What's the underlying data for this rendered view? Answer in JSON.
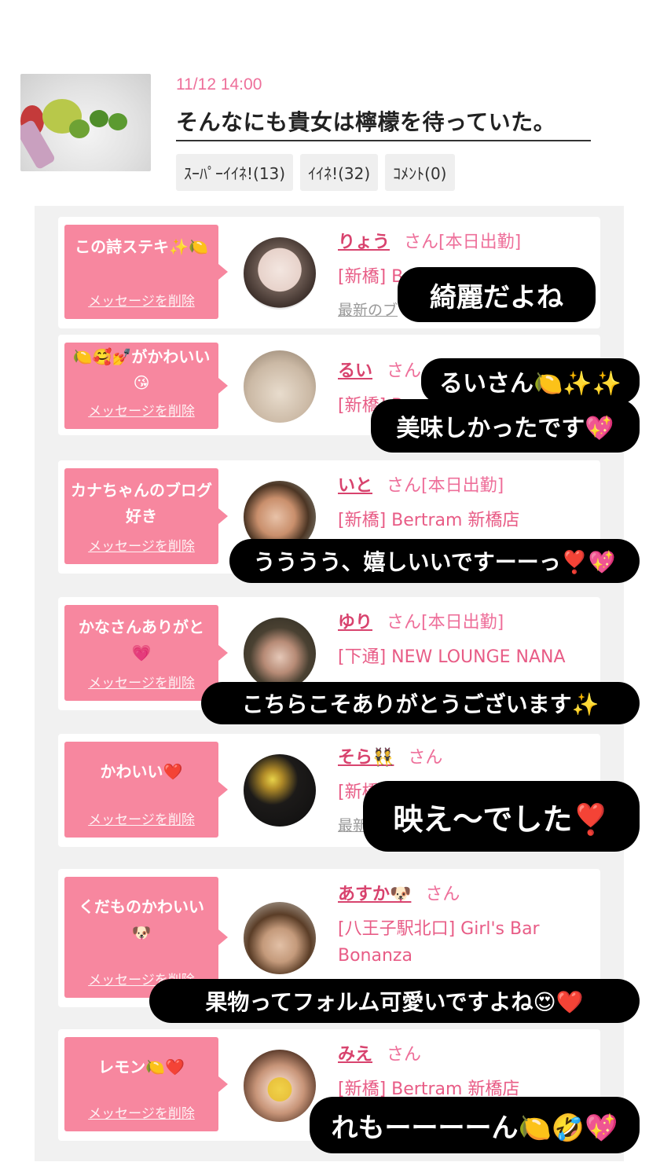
{
  "post": {
    "date": "11/12 14:00",
    "title": "そんなにも貴女は檸檬を待っていた。",
    "super_like": "ｽｰﾊﾟｰｲｲﾈ!(13)",
    "like": "ｲｲﾈ!(32)",
    "comment": "ｺﾒﾝﾄ(0)"
  },
  "delete_label": "メッセージを削除",
  "san_label": "さん",
  "messages": [
    {
      "text": "この詩ステキ✨🍋",
      "name": "りょう",
      "status": "さん[本日出勤]",
      "shop": "[新橋] Bertram 新橋店",
      "latest": "最新のブ"
    },
    {
      "text": "🍋🥰💅がかわいい😘",
      "name": "るい",
      "status": "さん",
      "shop": "[新橋] B",
      "latest": ""
    },
    {
      "text": "カナちゃんのブログ好き",
      "name": "いと",
      "status": "さん[本日出勤]",
      "shop": "[新橋] Bertram 新橋店",
      "latest": ""
    },
    {
      "text": "かなさんありがと💗",
      "name": "ゆり",
      "status": "さん[本日出勤]",
      "shop": "[下通] NEW LOUNGE NANA",
      "latest": ""
    },
    {
      "text": "かわいい❤️",
      "name": "そら👯",
      "status": "さん",
      "shop": "[新橋]",
      "latest": "最新"
    },
    {
      "text": "くだものかわいい🐶",
      "name": "あすか🐶",
      "status": "さん",
      "shop": "[八王子駅北口] Girl's Bar Bonanza",
      "latest": ""
    },
    {
      "text": "レモン🍋❤️",
      "name": "みえ",
      "status": "さん",
      "shop": "[新橋] Bertram 新橋店",
      "latest": ""
    }
  ],
  "overlays": [
    "綺麗だよね",
    "るいさん🍋✨✨",
    "美味しかったです💖",
    "うううう、嬉しいいですーーっ❣️💖",
    "こちらこそありがとうございます✨",
    "映え〜でした❣️",
    "果物ってフォルム可愛いですよね😍❤️",
    "れもーーーーん🍋🤣💖"
  ]
}
